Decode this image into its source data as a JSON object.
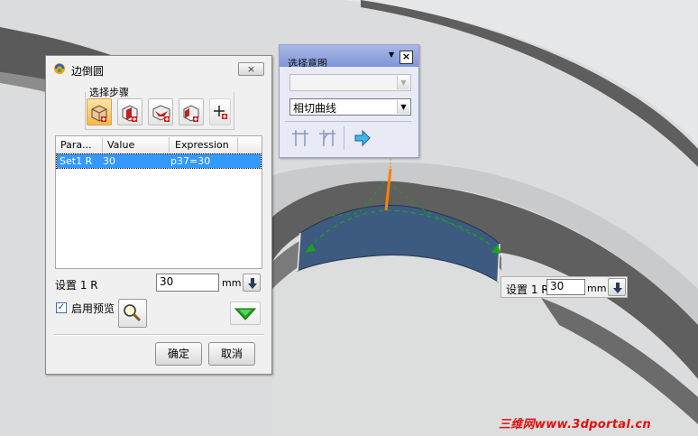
{
  "dialog": {
    "title": "边倒圆",
    "close_label": "×",
    "step_group_label": "选择步骤",
    "step_buttons": [
      "edge-select-icon",
      "blend-face-icon",
      "setback-icon",
      "stop-short-icon",
      "point-icon"
    ],
    "table": {
      "headers": [
        "Para...",
        "Value",
        "Expression"
      ],
      "rows": [
        {
          "param": "Set1 R",
          "value": "30",
          "expression": "p37=30"
        }
      ]
    },
    "set_label": "设置 1 R",
    "radius_value": "30",
    "unit": "mm",
    "preview_checkbox_label": "启用预览",
    "preview_checked": true,
    "ok_label": "确定",
    "cancel_label": "取消"
  },
  "selection_bar": {
    "title": "选择意图",
    "filter_value": "",
    "rule_value": "相切曲线",
    "close_label": "×"
  },
  "on_screen_input": {
    "label": "设置 1 R",
    "value": "30",
    "unit": "mm"
  },
  "watermark": "三维网www.3dportal.cn",
  "colors": {
    "selection_blue": "#3399ff",
    "blend_face": "#3d5a80",
    "model_gray": "#5e5e5e",
    "background": "#d9dadb",
    "edge_orange": "#ff8000",
    "preview_green": "#1aa31a"
  }
}
